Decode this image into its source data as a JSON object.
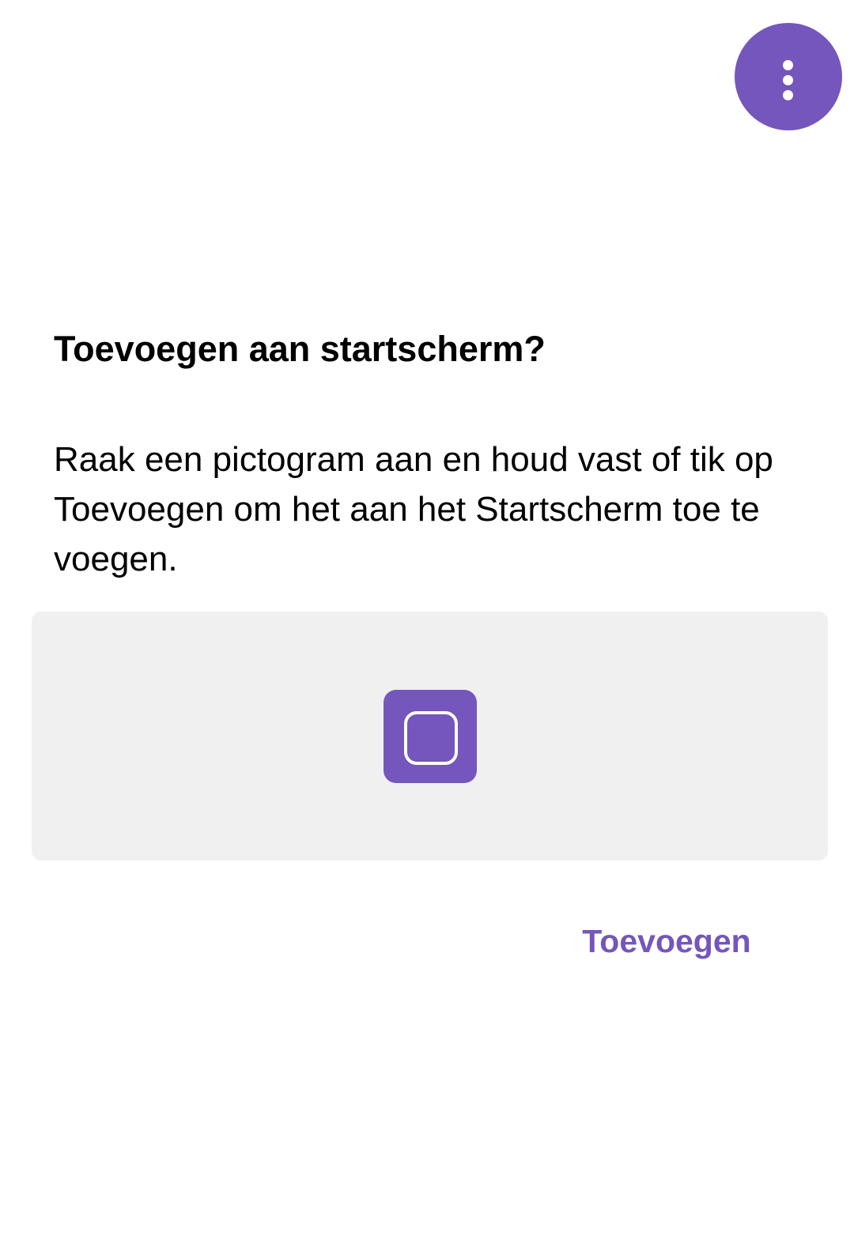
{
  "colors": {
    "accent": "#7456bc",
    "panel_background": "#f0f0f0",
    "text": "#000000"
  },
  "top_bar": {
    "more_button_icon": "more-vertical-icon"
  },
  "dialog": {
    "title": "Toevoegen aan startscherm?",
    "message": "Raak een pictogram aan en houd vast of tik op Toevoegen om het aan het Startscherm toe te voegen.",
    "preview": {
      "shortcut_icon": "rounded-square-app-icon"
    },
    "add_label": "Toevoegen"
  }
}
